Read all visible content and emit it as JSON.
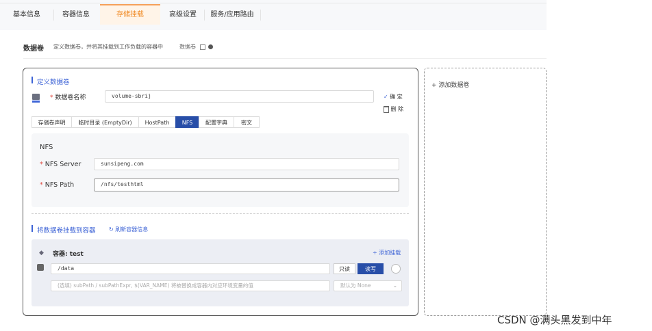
{
  "tabs": [
    {
      "label": "基本信息"
    },
    {
      "label": "容器信息"
    },
    {
      "label": "存储挂载"
    },
    {
      "label": "高级设置"
    },
    {
      "label": "服务/应用路由"
    }
  ],
  "section": {
    "title": "数据卷",
    "description": "定义数据卷，并将其挂载到工作负载的容器中",
    "link": "数据卷"
  },
  "define": {
    "title": "定义数据卷",
    "name_label": "数据卷名称",
    "name_value": "volume-sbrij",
    "confirm": "确 定",
    "delete": "删 除"
  },
  "volume_types": [
    {
      "label": "存储卷声明"
    },
    {
      "label": "临时目录 (EmptyDir)"
    },
    {
      "label": "HostPath"
    },
    {
      "label": "NFS"
    },
    {
      "label": "配置字典"
    },
    {
      "label": "密文"
    }
  ],
  "nfs": {
    "title": "NFS",
    "server_label": "NFS Server",
    "server_value": "sunsipeng.com",
    "path_label": "NFS Path",
    "path_value": "/nfs/testhtml"
  },
  "mount": {
    "title": "将数据卷挂载到容器",
    "refresh": "刷新容器信息",
    "container_label": "容器:",
    "container_name": "test",
    "add_mount": "添加挂载",
    "path_value": "/data",
    "readonly": "只读",
    "readwrite": "读写",
    "subpath_placeholder": "(选填) subPath / subPathExpr, $(VAR_NAME) 将被替换成容器内对应环境变量的值",
    "default_select": "默认为 None"
  },
  "add_volume": "添加数据卷",
  "watermark": "CSDN @满头黑发到中年",
  "colors": {
    "accent": "#284ea8",
    "active_tab": "#f08a24",
    "required": "#e0483e"
  }
}
